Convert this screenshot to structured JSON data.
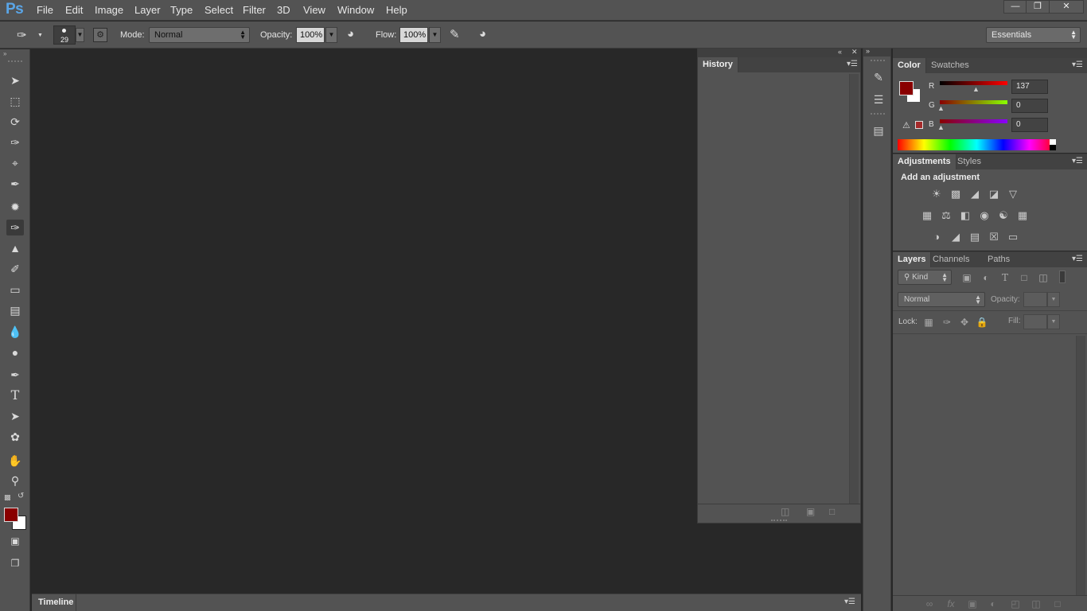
{
  "app": {
    "logo": "Ps",
    "menus": [
      "File",
      "Edit",
      "Image",
      "Layer",
      "Type",
      "Select",
      "Filter",
      "3D",
      "View",
      "Window",
      "Help"
    ]
  },
  "options": {
    "brush_size": "29",
    "mode_label": "Mode:",
    "mode_value": "Normal",
    "opacity_label": "Opacity:",
    "opacity_value": "100%",
    "flow_label": "Flow:",
    "flow_value": "100%",
    "workspace": "Essentials"
  },
  "history": {
    "tab": "History"
  },
  "timeline": {
    "label": "Timeline"
  },
  "color_panel": {
    "tabs": [
      "Color",
      "Swatches"
    ],
    "r_label": "R",
    "g_label": "G",
    "b_label": "B",
    "r_value": "137",
    "g_value": "0",
    "b_value": "0",
    "foreground_color": "#890000",
    "background_color": "#ffffff"
  },
  "adjustments_panel": {
    "tabs": [
      "Adjustments",
      "Styles"
    ],
    "heading": "Add an adjustment"
  },
  "layers_panel": {
    "tabs": [
      "Layers",
      "Channels",
      "Paths"
    ],
    "filter_kind": "Kind",
    "blend_mode": "Normal",
    "opacity_label": "Opacity:",
    "lock_label": "Lock:",
    "fill_label": "Fill:"
  },
  "colors": {
    "ui_gray": "#535353",
    "canvas_bg": "#282828",
    "logo_blue": "#5aa6e8"
  }
}
